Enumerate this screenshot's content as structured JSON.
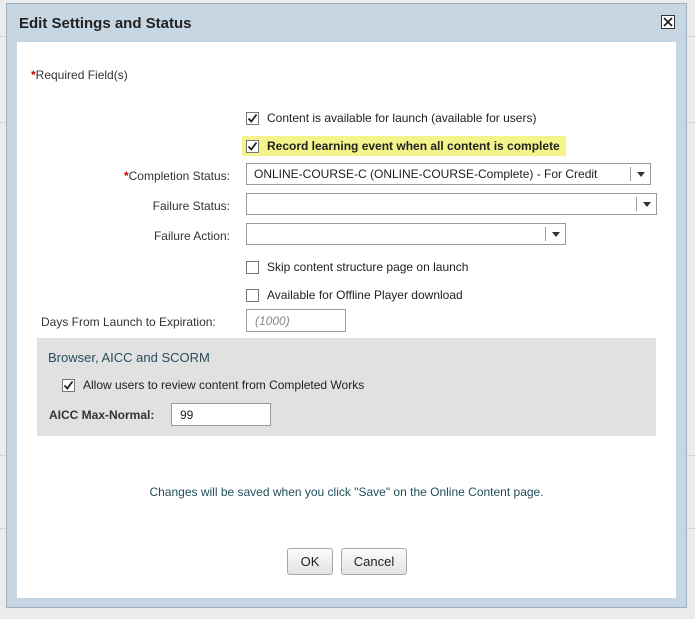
{
  "dialog": {
    "title": "Edit Settings and Status",
    "close_icon": "close-icon"
  },
  "form": {
    "required_note": "Required Field(s)",
    "required_mark": "*",
    "content_available": {
      "label": "Content is available for launch (available for users)",
      "checked": true
    },
    "record_learning": {
      "label": "Record learning event when all content is complete",
      "checked": true,
      "highlight_color": "#f5f48a"
    },
    "completion_status": {
      "label": "Completion Status:",
      "value": "ONLINE-COURSE-C (ONLINE-COURSE-Complete) - For Credit"
    },
    "failure_status": {
      "label": "Failure Status:",
      "value": ""
    },
    "failure_action": {
      "label": "Failure Action:",
      "value": ""
    },
    "skip_structure": {
      "label": "Skip content structure page on launch",
      "checked": false
    },
    "offline_player": {
      "label": "Available for Offline Player download",
      "checked": false
    },
    "days_expiration": {
      "label": "Days From Launch to Expiration:",
      "value": "",
      "placeholder": "(1000)"
    }
  },
  "section": {
    "title": "Browser, AICC and SCORM",
    "allow_review": {
      "label": "Allow users to review content from Completed Works",
      "checked": true
    },
    "aicc_max_normal": {
      "label": "AICC Max-Normal:",
      "value": "99"
    }
  },
  "info_text": "Changes will be saved when you click \"Save\" on the Online Content page.",
  "buttons": {
    "ok": "OK",
    "cancel": "Cancel"
  },
  "colors": {
    "dialog_frame": "#c7d6e3",
    "section_bg": "#e1e1e1",
    "required": "#cc0000",
    "info_text": "#1f4e5a"
  }
}
